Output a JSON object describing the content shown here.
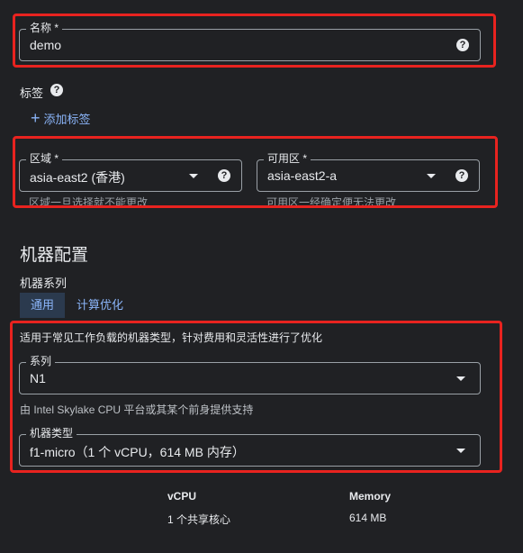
{
  "name": {
    "label": "名称 *",
    "value": "demo"
  },
  "labels": {
    "title": "标签",
    "add_label": "添加标签"
  },
  "region": {
    "label": "区域 *",
    "value": "asia-east2 (香港)",
    "hint": "区域一旦选择就不能更改"
  },
  "zone": {
    "label": "可用区 *",
    "value": "asia-east2-a",
    "hint": "可用区一经确定便无法更改"
  },
  "machine_config": {
    "title": "机器配置",
    "series_title": "机器系列",
    "tabs": [
      {
        "label": "通用",
        "active": true
      },
      {
        "label": "计算优化",
        "active": false
      }
    ],
    "description": "适用于常见工作负载的机器类型，针对费用和灵活性进行了优化",
    "series": {
      "label": "系列",
      "value": "N1",
      "hint": "由 Intel Skylake CPU 平台或其某个前身提供支持"
    },
    "machine_type": {
      "label": "机器类型",
      "value": "f1-micro（1 个 vCPU，614 MB 内存）"
    }
  },
  "specs": {
    "vcpu": {
      "header": "vCPU",
      "value": "1 个共享核心"
    },
    "memory": {
      "header": "Memory",
      "value": "614 MB"
    }
  },
  "colors": {
    "highlight": "#e8231f",
    "accent": "#8ab4f8",
    "active_tab_bg": "#2b3a4e"
  },
  "icons": [
    "help-icon",
    "plus-icon",
    "dropdown-caret-icon"
  ]
}
